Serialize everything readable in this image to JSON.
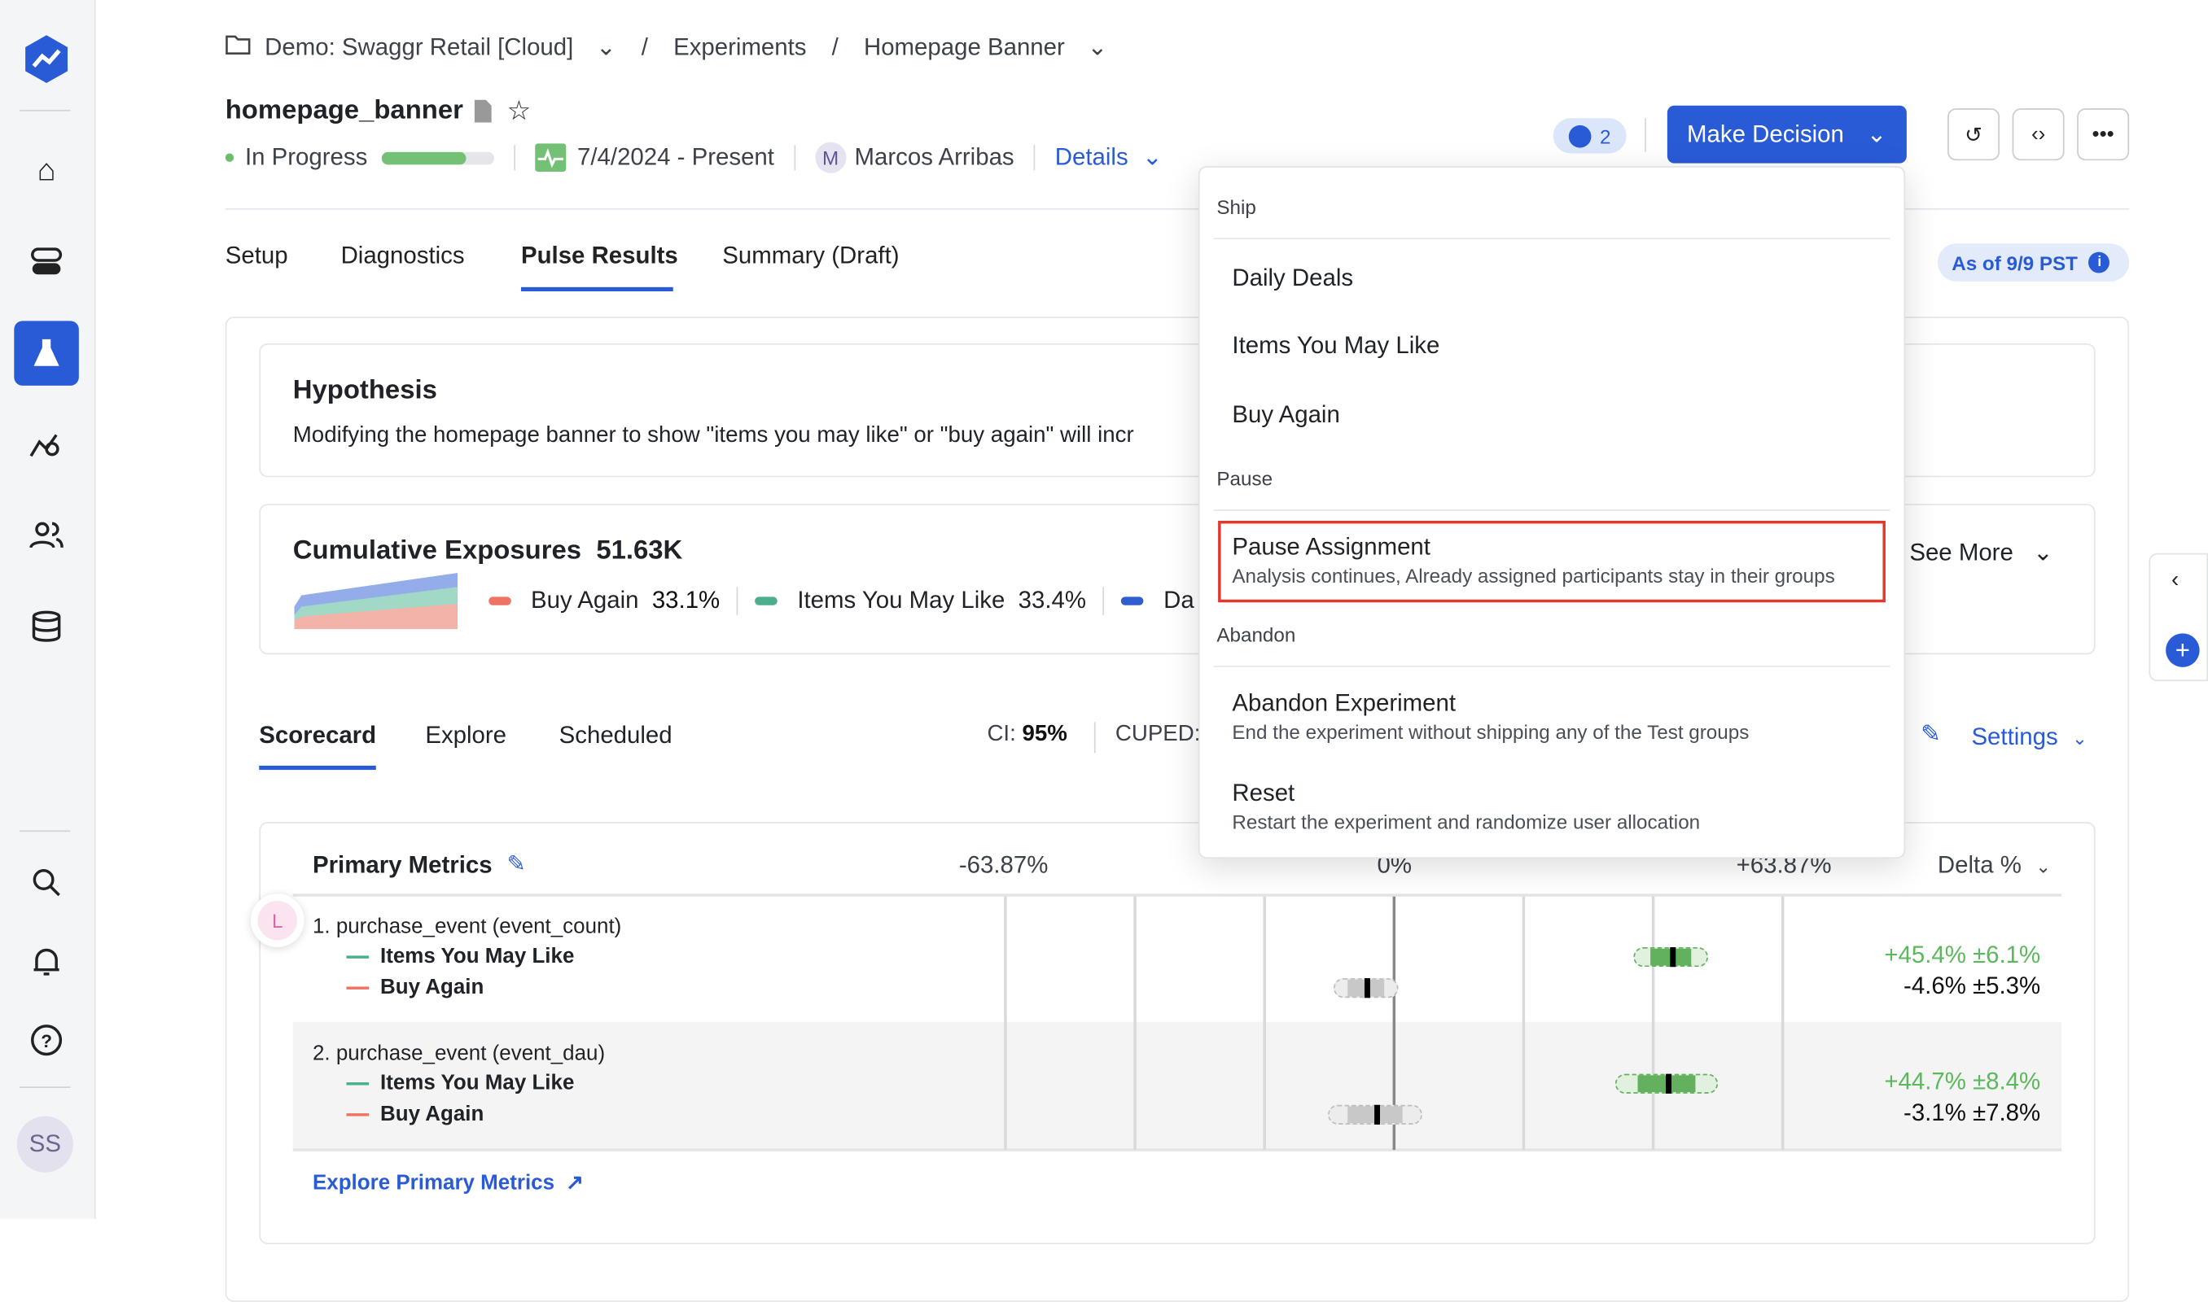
{
  "breadcrumb": {
    "project": "Demo: Swaggr Retail [Cloud]",
    "section": "Experiments",
    "experiment": "Homepage Banner",
    "sep": "/"
  },
  "header": {
    "title": "homepage_banner",
    "status": "In Progress",
    "progress": 0.75,
    "dates": "7/4/2024 - Present",
    "owner_initial": "M",
    "owner": "Marcos Arribas",
    "details": "Details",
    "badge_count": "2",
    "make_decision": "Make Decision"
  },
  "tabs": [
    "Setup",
    "Diagnostics",
    "Pulse Results",
    "Summary (Draft)"
  ],
  "active_tab": "Pulse Results",
  "as_of": "As of 9/9 PST",
  "hypothesis": {
    "title": "Hypothesis",
    "text": "Modifying the homepage banner to show \"items you may like\" or \"buy again\" will incr"
  },
  "exposures": {
    "title": "Cumulative Exposures",
    "total": "51.63K",
    "see_more": "See More",
    "groups": [
      {
        "name": "Buy Again",
        "pct": "33.1%",
        "color": "#ef7363"
      },
      {
        "name": "Items You May Like",
        "pct": "33.4%",
        "color": "#4caf8c"
      },
      {
        "name": "Da",
        "pct": "",
        "color": "#2f5fcf"
      }
    ]
  },
  "scorecard": {
    "tabs": [
      "Scorecard",
      "Explore",
      "Scheduled"
    ],
    "ci_label": "CI:",
    "ci_value": "95%",
    "cuped": "CUPED:",
    "settings": "Settings"
  },
  "metrics": {
    "title": "Primary Metrics",
    "axis": [
      "-63.87%",
      "0%",
      "+63.87%"
    ],
    "delta_label": "Delta %",
    "explore_link": "Explore Primary Metrics",
    "avatar_initial": "L",
    "rows": [
      {
        "name": "1. purchase_event (event_count)",
        "groups": [
          {
            "name": "Items You May Like",
            "delta": 45.4,
            "ci": 6.1,
            "label": "+45.4% ±6.1%",
            "significant": true,
            "color": "#4caf8c"
          },
          {
            "name": "Buy Again",
            "delta": -4.6,
            "ci": 5.3,
            "label": "-4.6% ±5.3%",
            "significant": false,
            "color": "#ef7363"
          }
        ]
      },
      {
        "name": "2. purchase_event (event_dau)",
        "groups": [
          {
            "name": "Items You May Like",
            "delta": 44.7,
            "ci": 8.4,
            "label": "+44.7% ±8.4%",
            "significant": true,
            "color": "#4caf8c"
          },
          {
            "name": "Buy Again",
            "delta": -3.1,
            "ci": 7.8,
            "label": "-3.1% ±7.8%",
            "significant": false,
            "color": "#ef7363"
          }
        ]
      }
    ]
  },
  "decision_menu": {
    "ship_label": "Ship",
    "ship_items": [
      "Daily Deals",
      "Items You May Like",
      "Buy Again"
    ],
    "pause_label": "Pause",
    "pause_item": "Pause Assignment",
    "pause_desc": "Analysis continues, Already assigned participants stay in their groups",
    "abandon_label": "Abandon",
    "abandon_item": "Abandon Experiment",
    "abandon_desc": "End the experiment without shipping any of the Test groups",
    "reset_item": "Reset",
    "reset_desc": "Restart the experiment and randomize user allocation"
  },
  "sidebar": {
    "user_initials": "SS"
  },
  "colors": {
    "accent": "#2a5bd7",
    "positive": "#5cb85c",
    "highlight": "#e0392b"
  }
}
